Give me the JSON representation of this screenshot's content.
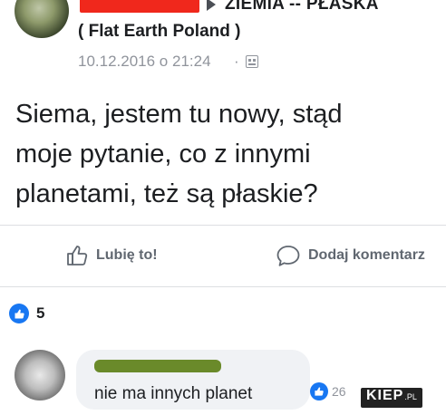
{
  "post": {
    "group_name": "ZIEMIA -- PŁASKA",
    "group_subtitle": "( Flat Earth Poland )",
    "date": "10.12.2016 o 21:24",
    "separator": "·",
    "audience_icon": "group-audience-icon",
    "body": "Siema, jestem tu nowy, stąd\nmoje pytanie, co z innymi\nplanetami, też są płaskie?"
  },
  "actions": {
    "like_label": "Lubię to!",
    "comment_label": "Dodaj komentarz"
  },
  "reactions": {
    "icon": "like-icon",
    "count": "5"
  },
  "comment": {
    "text": "nie ma innych planet",
    "reaction_count": "26"
  },
  "watermark": {
    "main": "KIEP",
    "suffix": ".PL"
  },
  "colors": {
    "facebook_blue": "#1877f2",
    "redaction_red": "#f0281c",
    "redaction_green": "#6a8a2a",
    "meta_gray": "#90949c"
  }
}
